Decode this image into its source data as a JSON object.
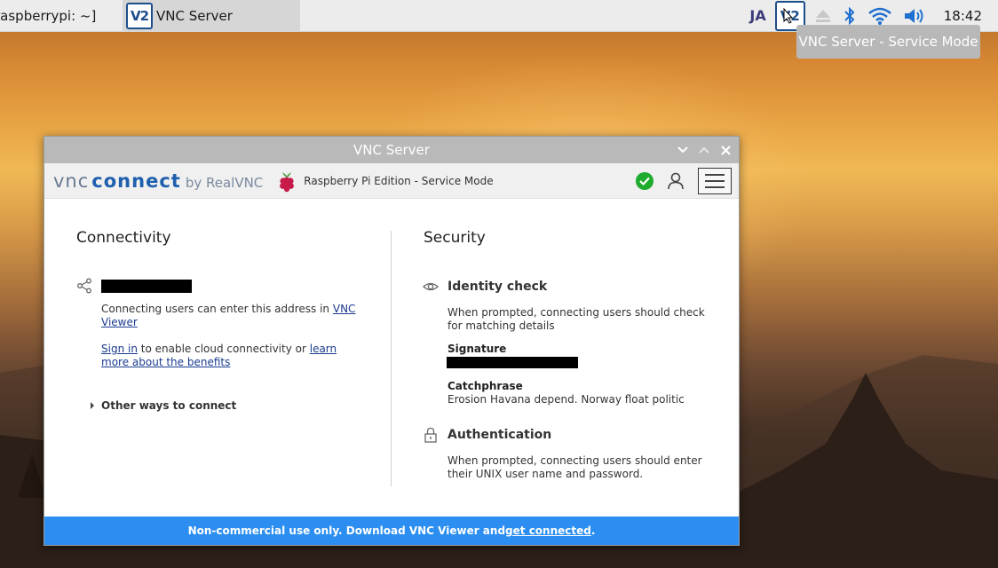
{
  "taskbar": {
    "terminal_label": "raspberrypi: ~]",
    "vnc_task_label": "VNC Server",
    "vnc_logo_text": "V2",
    "tray_lang": "JA",
    "clock": "18:42"
  },
  "tooltip": {
    "text": "VNC Server - Service Mode"
  },
  "window": {
    "title": "VNC Server",
    "brand": {
      "vnc": "vnc",
      "connect": "connect",
      "by": "by RealVNC"
    },
    "edition": "Raspberry Pi Edition - Service Mode",
    "connectivity": {
      "title": "Connectivity",
      "address_hint_pre": "Connecting users can enter this address in ",
      "address_hint_link": "VNC Viewer",
      "signin_link": "Sign in",
      "signin_mid": " to enable cloud connectivity or ",
      "learn_link": "learn more about the benefits",
      "other_ways": "Other ways to connect"
    },
    "security": {
      "title": "Security",
      "identity_title": "Identity check",
      "identity_desc": "When prompted, connecting users should check for matching details",
      "signature_label": "Signature",
      "catchphrase_label": "Catchphrase",
      "catchphrase_value": "Erosion Havana depend. Norway float politic",
      "auth_title": "Authentication",
      "auth_desc": "When prompted, connecting users should enter their UNIX user name and password."
    },
    "footer": {
      "text_pre": "Non-commercial use only. Download VNC Viewer and ",
      "link": "get connected",
      "text_post": "."
    }
  },
  "colors": {
    "accent_blue": "#2b8ef0",
    "brand_blue": "#1e5fae",
    "status_green": "#1fab2d"
  }
}
